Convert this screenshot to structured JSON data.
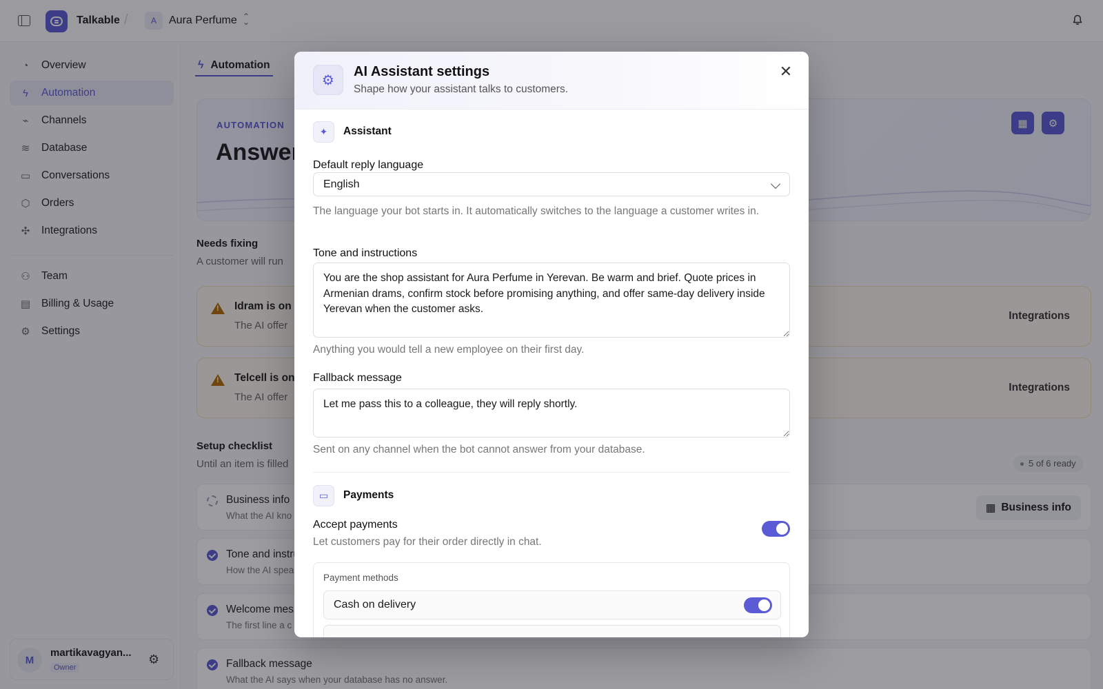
{
  "topbar": {
    "app_name": "Talkable",
    "workspace_initial": "A",
    "workspace_name": "Aura Perfume"
  },
  "sidebar": {
    "items": [
      {
        "label": "Overview",
        "icon": "gauge-icon"
      },
      {
        "label": "Automation",
        "icon": "bolt-icon",
        "active": true
      },
      {
        "label": "Channels",
        "icon": "plug-icon"
      },
      {
        "label": "Database",
        "icon": "database-icon"
      },
      {
        "label": "Conversations",
        "icon": "chat-icon"
      },
      {
        "label": "Orders",
        "icon": "box-icon"
      },
      {
        "label": "Integrations",
        "icon": "puzzle-icon"
      }
    ],
    "secondary_items": [
      {
        "label": "Team",
        "icon": "users-icon"
      },
      {
        "label": "Billing & Usage",
        "icon": "card-icon"
      },
      {
        "label": "Settings",
        "icon": "gear-icon"
      }
    ],
    "user": {
      "initial": "M",
      "name": "martikavagyan...",
      "role": "Owner"
    }
  },
  "main": {
    "tab_label": "Automation",
    "hero": {
      "kicker": "AUTOMATION",
      "title": "Answer"
    },
    "needs_fixing": {
      "title": "Needs fixing",
      "subtitle": "A customer will run",
      "cards": [
        {
          "title": "Idram is on b",
          "subtitle": "The AI offer",
          "action": "Integrations"
        },
        {
          "title": "Telcell is on b",
          "subtitle": "The AI offer",
          "action": "Integrations"
        }
      ]
    },
    "checklist": {
      "title": "Setup checklist",
      "subtitle": "Until an item is filled",
      "badge": "5 of 6 ready",
      "items": [
        {
          "title": "Business info",
          "subtitle": "What the AI kno",
          "status": "pending",
          "action": "Business info"
        },
        {
          "title": "Tone and instru",
          "subtitle": "How the AI spea",
          "status": "done"
        },
        {
          "title": "Welcome mes",
          "subtitle": "The first line a c",
          "status": "done"
        },
        {
          "title": "Fallback message",
          "subtitle": "What the AI says when your database has no answer.",
          "status": "done"
        }
      ]
    }
  },
  "modal": {
    "title": "AI Assistant settings",
    "subtitle": "Shape how your assistant talks to customers.",
    "assistant_section": "Assistant",
    "language": {
      "label": "Default reply language",
      "value": "English",
      "help": "The language your bot starts in. It automatically switches to the language a customer writes in."
    },
    "tone": {
      "label": "Tone and instructions",
      "value": "You are the shop assistant for Aura Perfume in Yerevan. Be warm and brief. Quote prices in Armenian drams, confirm stock before promising anything, and offer same-day delivery inside Yerevan when the customer asks.",
      "help": "Anything you would tell a new employee on their first day."
    },
    "fallback": {
      "label": "Fallback message",
      "value": "Let me pass this to a colleague, they will reply shortly.",
      "help": "Sent on any channel when the bot cannot answer from your database."
    },
    "payments_section": "Payments",
    "accept_payments": {
      "label": "Accept payments",
      "help": "Let customers pay for their order directly in chat.",
      "enabled": true
    },
    "payment_methods": {
      "title": "Payment methods",
      "items": [
        {
          "label": "Cash on delivery",
          "enabled": true
        }
      ]
    }
  },
  "colors": {
    "accent": "#5b5bd6",
    "warning": "#b36b00"
  }
}
